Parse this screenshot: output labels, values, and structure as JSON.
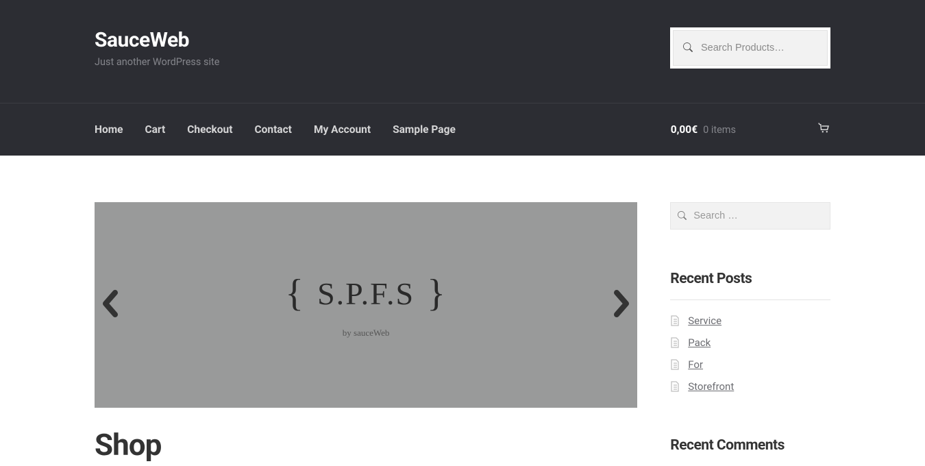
{
  "site": {
    "title": "SauceWeb",
    "tagline": "Just another WordPress site"
  },
  "header_search": {
    "placeholder": "Search Products…"
  },
  "nav": {
    "items": [
      {
        "label": "Home"
      },
      {
        "label": "Cart"
      },
      {
        "label": "Checkout"
      },
      {
        "label": "Contact"
      },
      {
        "label": "My Account"
      },
      {
        "label": "Sample Page"
      }
    ]
  },
  "cart": {
    "amount": "0,00€",
    "items": "0 items"
  },
  "slider": {
    "logo_text": "S.P.F.S",
    "subtitle": "by sauceWeb"
  },
  "page": {
    "heading": "Shop"
  },
  "sidebar": {
    "search_placeholder": "Search …",
    "recent_posts_title": "Recent Posts",
    "recent_posts": [
      {
        "label": "Service"
      },
      {
        "label": "Pack"
      },
      {
        "label": "For"
      },
      {
        "label": "Storefront"
      }
    ],
    "recent_comments_title": "Recent Comments"
  }
}
